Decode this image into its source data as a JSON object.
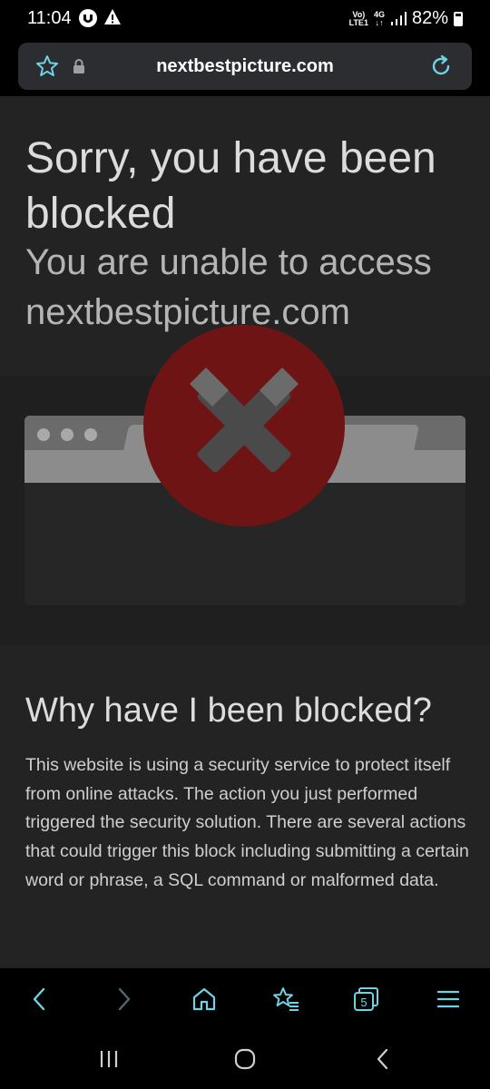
{
  "status_bar": {
    "time": "11:04",
    "network_top": "Vo)",
    "network_bottom": "LTE1",
    "net_type": "4G",
    "battery": "82%"
  },
  "url_bar": {
    "url": "nextbestpicture.com"
  },
  "page": {
    "title": "Sorry, you have been blocked",
    "subtitle": "You are unable to access nextbestpicture.com",
    "why_title": "Why have I been blocked?",
    "why_text": "This website is using a security service to protect itself from online attacks. The action you just performed triggered the security solution. There are several actions that could trigger this block including submitting a certain word or phrase, a SQL command or malformed data."
  },
  "toolbar": {
    "tab_count": "5"
  },
  "colors": {
    "accent": "#6fd3e6",
    "blocked_red": "#7a1414",
    "page_bg": "#222222"
  }
}
